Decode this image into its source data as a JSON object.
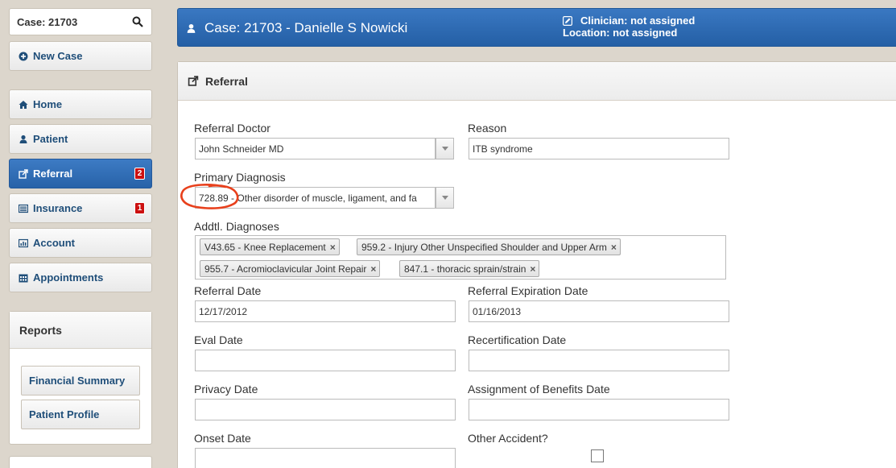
{
  "sidebar": {
    "search": {
      "value": "Case: 21703"
    },
    "new_case": "New Case",
    "nav": [
      {
        "label": "Home"
      },
      {
        "label": "Patient"
      },
      {
        "label": "Referral",
        "badge": "2"
      },
      {
        "label": "Insurance",
        "badge": "1"
      },
      {
        "label": "Account"
      },
      {
        "label": "Appointments"
      }
    ],
    "reports": {
      "title": "Reports",
      "items": [
        "Financial Summary",
        "Patient Profile"
      ]
    }
  },
  "header": {
    "title": "Case: 21703 - Danielle S Nowicki",
    "clinician": "Clinician: not assigned",
    "location": "Location: not assigned"
  },
  "panel": {
    "title": "Referral",
    "referral_doctor": {
      "label": "Referral Doctor",
      "value": "John  Schneider  MD"
    },
    "reason": {
      "label": "Reason",
      "value": "ITB syndrome"
    },
    "primary_diagnosis": {
      "label": "Primary Diagnosis",
      "value": "728.89 - Other disorder of muscle, ligament, and fa"
    },
    "additional_diagnoses": {
      "label": "Addtl. Diagnoses",
      "tags": [
        "V43.65 - Knee Replacement",
        "959.2 - Injury Other Unspecified Shoulder and Upper Arm",
        "955.7 - Acromioclavicular Joint Repair",
        "847.1 - thoracic sprain/strain"
      ]
    },
    "referral_date": {
      "label": "Referral Date",
      "value": "12/17/2012"
    },
    "referral_expiration_date": {
      "label": "Referral Expiration Date",
      "value": "01/16/2013"
    },
    "eval_date": {
      "label": "Eval Date",
      "value": ""
    },
    "recertification_date": {
      "label": "Recertification Date",
      "value": ""
    },
    "privacy_date": {
      "label": "Privacy Date",
      "value": ""
    },
    "assignment_of_benefits_date": {
      "label": "Assignment of Benefits Date",
      "value": ""
    },
    "onset_date": {
      "label": "Onset Date",
      "value": ""
    },
    "other_accident": {
      "label": "Other Accident?",
      "checked": false
    }
  },
  "colors": {
    "accent": "#2f6db5",
    "badge": "#cc1010",
    "annotation": "#e8401c"
  }
}
